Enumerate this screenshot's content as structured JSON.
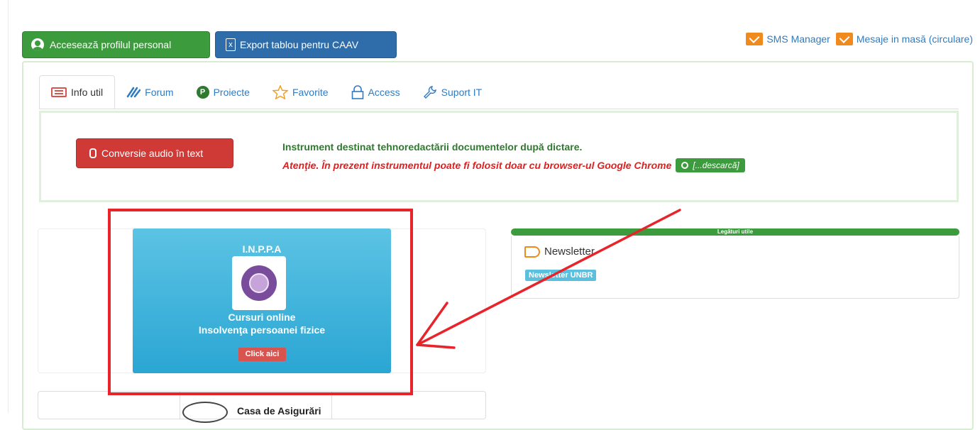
{
  "top_buttons": {
    "profile_label": "Accesează profilul personal",
    "export_label": "Export tablou pentru CAAV",
    "export_icon_glyph": "x"
  },
  "top_links": [
    {
      "label": "SMS Manager",
      "icon": "mail-icon"
    },
    {
      "label": "Mesaje in masă (circulare)",
      "icon": "mail-icon"
    }
  ],
  "tabs": [
    {
      "label": "Info util",
      "icon": "newspaper-icon",
      "active": true
    },
    {
      "label": "Forum",
      "icon": "forum-icon",
      "active": false
    },
    {
      "label": "Proiecte",
      "icon": "p-circle-icon",
      "icon_glyph": "P",
      "active": false
    },
    {
      "label": "Favorite",
      "icon": "star-icon",
      "active": false
    },
    {
      "label": "Access",
      "icon": "lock-icon",
      "active": false
    },
    {
      "label": "Suport IT",
      "icon": "wrench-icon",
      "active": false
    }
  ],
  "audio": {
    "button_label": "Conversie audio în text",
    "description": "Instrument destinat tehnoredactării documentelor după dictare.",
    "warning": "Atenţie. În prezent instrumentul poate fi folosit doar cu browser-ul Google Chrome",
    "download_label": "[...descarcă]"
  },
  "inppa_card": {
    "title": "I.N.P.P.A",
    "subtitle_line1": "Cursuri online",
    "subtitle_line2": "Insolvenţa persoanei fizice",
    "button_label": "Click aici"
  },
  "second_card": {
    "title": "Casa de Asigurări"
  },
  "useful_links": {
    "header": "Legături utile",
    "newsletter_title": "Newsletter",
    "newsletter_badge": "Newsletter UNBR"
  },
  "colors": {
    "green": "#3c9b3c",
    "blue": "#2e6daa",
    "red": "#cf3a36",
    "annotation_red": "#e8232a",
    "link_blue": "#2f7bc2",
    "card_cyan": "#2aa6d3"
  }
}
